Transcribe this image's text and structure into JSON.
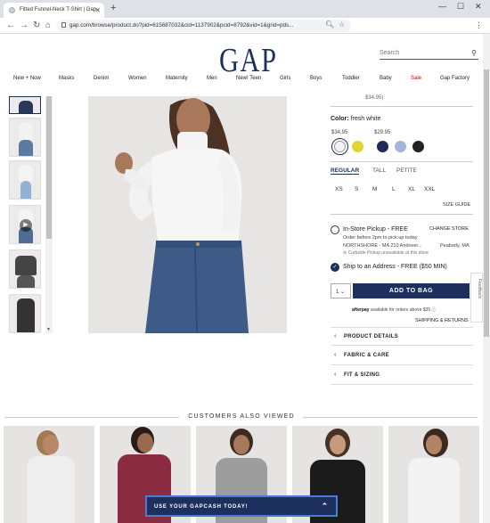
{
  "browser": {
    "tab_title": "Fitted Funnel-Neck T-Shirt | Gap",
    "url": "gap.com/browse/product.do?pid=615687032&cid=1137902&pcid=8792&vid=1&grid=pds..."
  },
  "header": {
    "logo": "GAP",
    "search_placeholder": "Search"
  },
  "nav": [
    "New + Now",
    "Masks",
    "Denim",
    "Women",
    "Maternity",
    "Men",
    "New! Teen",
    "Girls",
    "Boys",
    "Toddler",
    "Baby",
    "Sale",
    "Gap Factory"
  ],
  "product": {
    "price_partial": "$34.95)",
    "color_label": "Color:",
    "color_value": "fresh white",
    "price_group_1": "$34.95",
    "price_group_2": "$29.95",
    "swatches_g1": [
      "#f2f2f4",
      "#e0d534"
    ],
    "swatches_g2": [
      "#22285a",
      "#a5b4dc",
      "#222222"
    ],
    "fit_tabs": [
      "REGULAR",
      "TALL",
      "PETITE"
    ],
    "sizes": [
      "XS",
      "S",
      "M",
      "L",
      "XL",
      "XXL"
    ],
    "size_guide": "SIZE GUIDE",
    "pickup_title": "In-Store Pickup - FREE",
    "change_store": "CHANGE STORE",
    "pickup_line1": "Order before 2pm to pick up today",
    "pickup_line2": "NORTHSHORE - MA 210 Andover...",
    "pickup_city": "Peabody, MA",
    "pickup_line3": "⊘ Curbside Pickup unavailable at this store",
    "ship_title": "Ship to an Address - FREE ($50 MIN)",
    "qty": "1",
    "add_to_bag": "ADD TO BAG",
    "afterpay_brand": "afterpay",
    "afterpay_text": "available for orders above $35 ⓘ",
    "shipping_returns": "SHIPPING & RETURNS",
    "accordions": [
      "PRODUCT DETAILS",
      "FABRIC & CARE",
      "FIT & SIZING"
    ]
  },
  "feedback": "Feedback",
  "cav_title": "CUSTOMERS ALSO VIEWED",
  "cav_items": [
    {
      "shirt": "#eeeeee",
      "hair": "#a07a52"
    },
    {
      "shirt": "#8b2b41",
      "hair": "#2a1c15"
    },
    {
      "shirt": "#9d9d9d",
      "hair": "#3b2b20"
    },
    {
      "shirt": "#1b1b1b",
      "hair": "#4a3225"
    },
    {
      "shirt": "#f3f3f3",
      "hair": "#3d2a1e"
    }
  ],
  "gapcash": "USE YOUR GAPCASH TODAY!"
}
